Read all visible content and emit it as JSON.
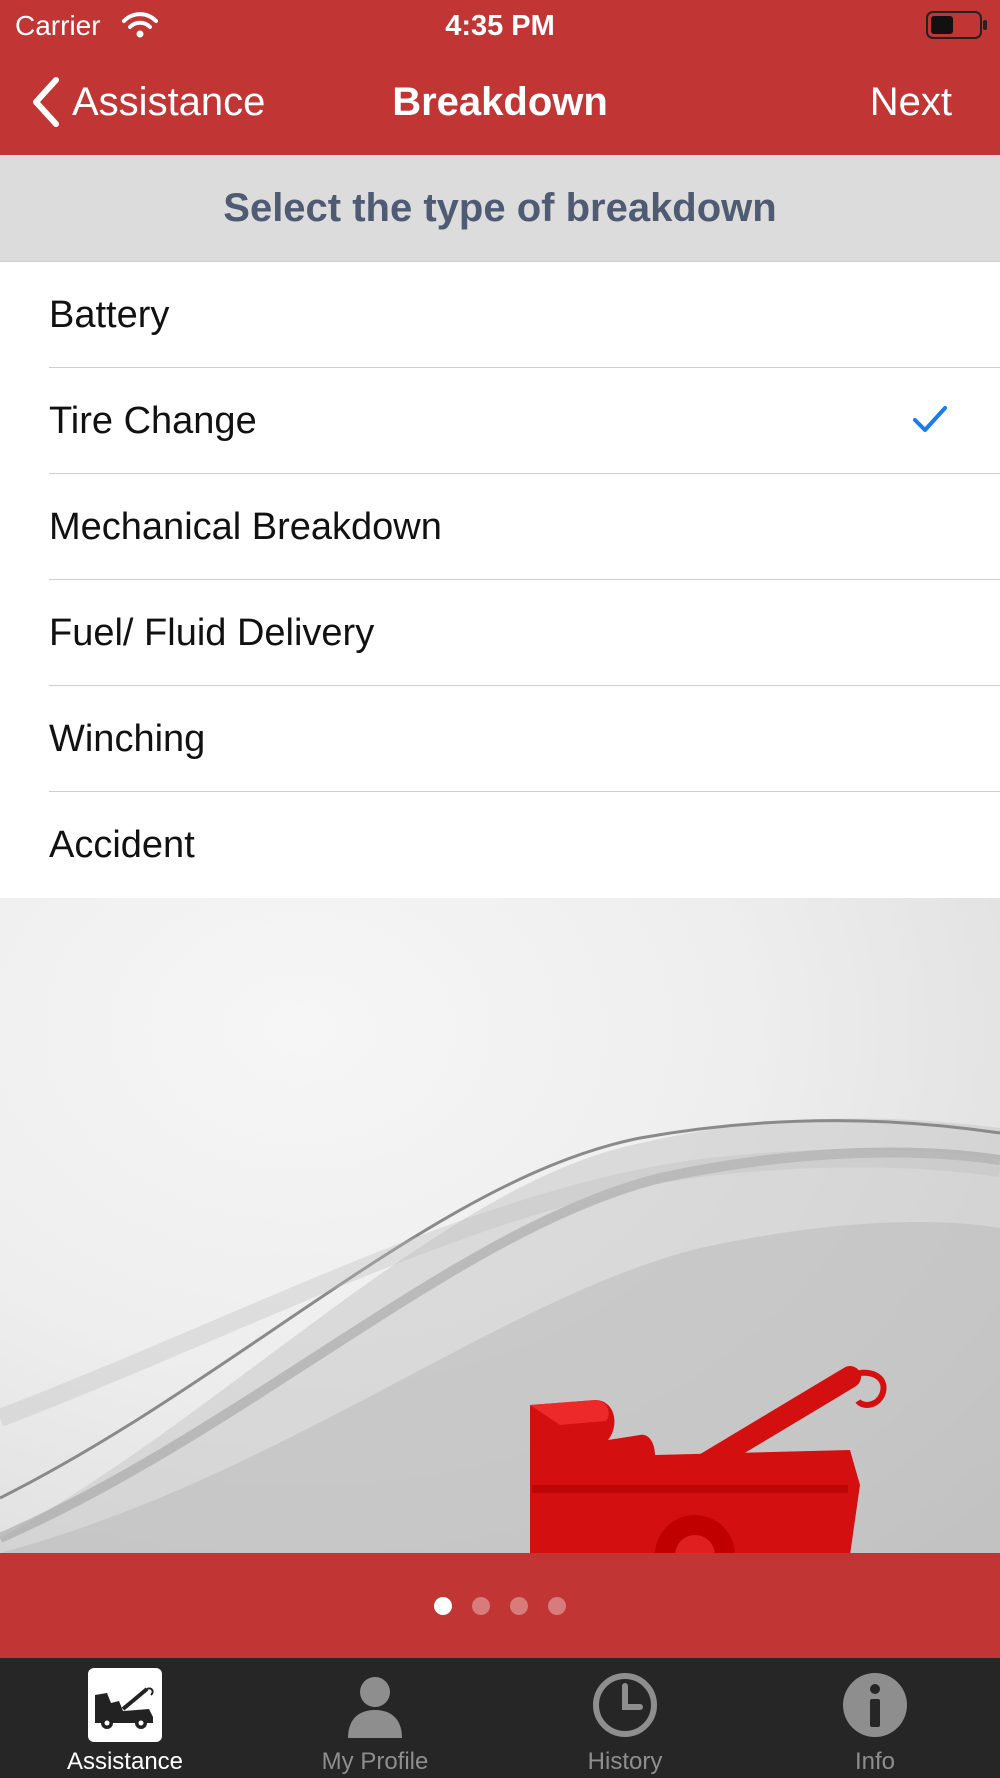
{
  "status_bar": {
    "carrier": "Carrier",
    "time": "4:35 PM"
  },
  "nav": {
    "back_label": "Assistance",
    "title": "Breakdown",
    "next_label": "Next"
  },
  "section": {
    "title": "Select the type of breakdown"
  },
  "options": [
    {
      "label": "Battery",
      "selected": false
    },
    {
      "label": "Tire Change",
      "selected": true
    },
    {
      "label": "Mechanical Breakdown",
      "selected": false
    },
    {
      "label": "Fuel/ Fluid Delivery",
      "selected": false
    },
    {
      "label": "Winching",
      "selected": false
    },
    {
      "label": "Accident",
      "selected": false
    }
  ],
  "pager": {
    "count": 4,
    "active_index": 0
  },
  "tabs": [
    {
      "label": "Assistance",
      "icon": "tow-truck-icon",
      "active": true
    },
    {
      "label": "My Profile",
      "icon": "person-icon",
      "active": false
    },
    {
      "label": "History",
      "icon": "clock-icon",
      "active": false
    },
    {
      "label": "Info",
      "icon": "info-icon",
      "active": false
    }
  ],
  "colors": {
    "brand_red": "#c23535",
    "header_gray": "#dcdcdc",
    "section_text": "#4f5b73",
    "checkmark_blue": "#1a7cf0",
    "tabbar_bg": "#262626"
  }
}
